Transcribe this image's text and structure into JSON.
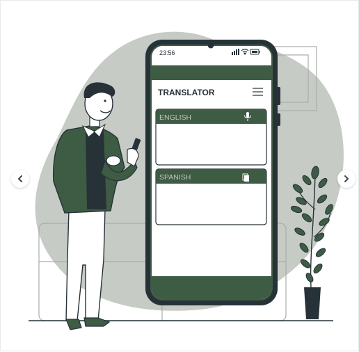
{
  "phone": {
    "time": "23:56",
    "app_title": "TRANSLATOR",
    "source_panel": {
      "language": "ENGLISH",
      "icon": "microphone-icon"
    },
    "target_panel": {
      "language": "SPANISH",
      "icon": "copy-icon"
    },
    "menu_icon": "hamburger-menu-icon"
  },
  "carousel": {
    "prev_icon": "chevron-left-icon",
    "next_icon": "chevron-right-icon"
  },
  "colors": {
    "accent": "#3e5b44",
    "blob": "#c6cbc5",
    "outline": "#263238",
    "white": "#ffffff"
  }
}
